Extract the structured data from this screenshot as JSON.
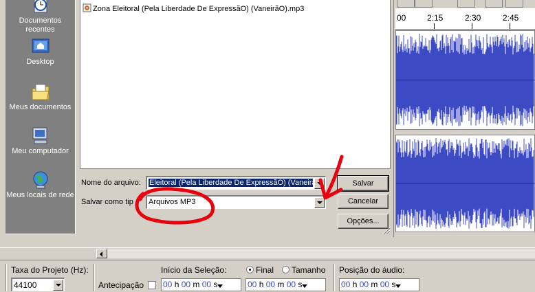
{
  "places": [
    {
      "label": "Documentos recentes",
      "icon": "recent-documents-icon"
    },
    {
      "label": "Desktop",
      "icon": "desktop-icon"
    },
    {
      "label": "Meus documentos",
      "icon": "my-documents-icon"
    },
    {
      "label": "Meu computador",
      "icon": "my-computer-icon"
    },
    {
      "label": "Meus locais de rede",
      "icon": "network-places-icon"
    }
  ],
  "file_list": [
    {
      "name": "Zona Eleitoral (Pela Liberdade De ExpressãO) (VaneirãO).mp3",
      "icon": "mp3-file-icon"
    }
  ],
  "form": {
    "filename_label": "Nome do arquivo:",
    "filename_value": "Eleitoral (Pela Liberdade De ExpressãO) (VaneirãO)",
    "filetype_label": "Salvar como tip",
    "filetype_value": "Arquivos MP3"
  },
  "buttons": {
    "save": "Salvar",
    "cancel": "Cancelar",
    "options": "Opções..."
  },
  "timeline": {
    "ticks": [
      "00",
      "2:15",
      "2:30",
      "2:45"
    ]
  },
  "selection_bar": {
    "project_rate_label": "Taxa do Projeto (Hz):",
    "project_rate_value": "44100",
    "snap_label": "Antecipação",
    "selection_start_label": "Início da Seleção:",
    "end_label": "Final",
    "length_label": "Tamanho",
    "end_selected": true,
    "audio_position_label": "Posição do áudio:",
    "start_time": {
      "h": "00",
      "m": "00",
      "s": "00"
    },
    "end_time": {
      "h": "00",
      "m": "00",
      "s": "00"
    },
    "position_time": {
      "h": "00",
      "m": "00",
      "s": "00"
    }
  },
  "colors": {
    "waveform": "#3c4ac4",
    "annotation": "#e8000e",
    "selection": "#0a246a"
  }
}
